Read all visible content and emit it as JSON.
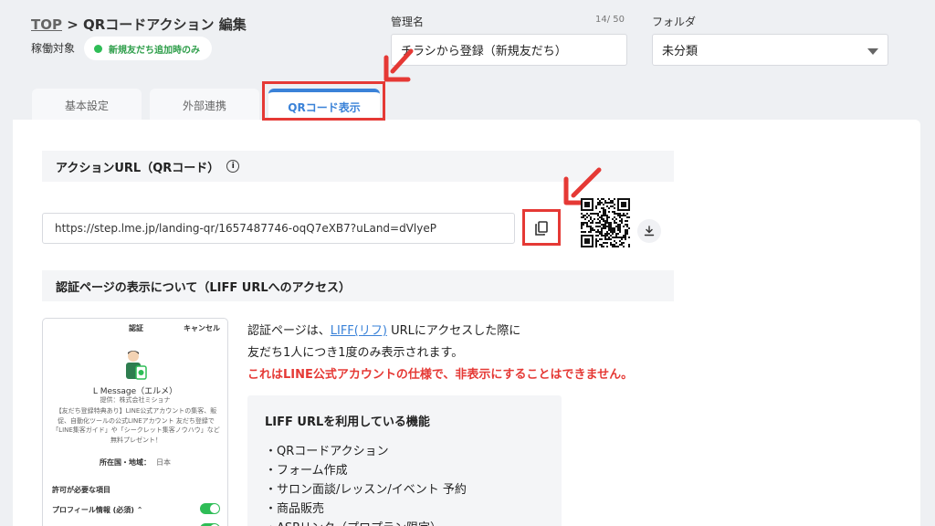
{
  "breadcrumb": {
    "top": "TOP",
    "separator": " > ",
    "title": "QRコードアクション 編集"
  },
  "status": {
    "label": "稼働対象",
    "badge": "新規友だち追加時のみ",
    "badge_color": "#2ebd56"
  },
  "management_name": {
    "label": "管理名",
    "counter": "14/ 50",
    "value": "チラシから登録（新規友だち）"
  },
  "folder": {
    "label": "フォルダ",
    "value": "未分類"
  },
  "tabs": [
    "基本設定",
    "外部連携",
    "QRコード表示"
  ],
  "action_url": {
    "heading": "アクションURL（QRコード）",
    "info_icon": "i",
    "url": "https://step.lme.jp/landing-qr/1657487746-oqQ7eXB7?uLand=dVlyeP"
  },
  "auth": {
    "heading": "認証ページの表示について（LIFF URLへのアクセス）",
    "preview": {
      "title": "認証",
      "cancel": "キャンセル",
      "name": "L Message（エルメ）",
      "provider": "提供：株式会社ミショナ",
      "description": "【友だち登録特典あり】LINE公式アカウントの集客、販促、自動化ツールの公式LINEアカウント 友だち登録で「LINE集客ガイド」や「シークレット集客ノウハウ」など無料プレゼント！",
      "region_label": "所在国・地域：",
      "region_value": "日本",
      "perm_heading": "許可が必要な項目",
      "perm_item": "プロフィール情報 (必須)"
    },
    "text1_before": "認証ページは、",
    "text1_link": "LIFF(リフ)",
    "text1_after": " URLにアクセスした際に",
    "text2": "友だち1人につき1度のみ表示されます。",
    "warning": "これはLINE公式アカウントの仕様で、非表示にすることはできません。",
    "warning_color": "#e53935"
  },
  "features": {
    "title": "LIFF URLを利用している機能",
    "items": [
      "・QRコードアクション",
      "・フォーム作成",
      "・サロン面談/レッスン/イベント 予約",
      "・商品販売",
      "・ASPリンク（プロプラン限定）"
    ]
  },
  "colors": {
    "accent": "#3a82d8",
    "highlight": "#e53935",
    "green": "#2ebd56"
  }
}
